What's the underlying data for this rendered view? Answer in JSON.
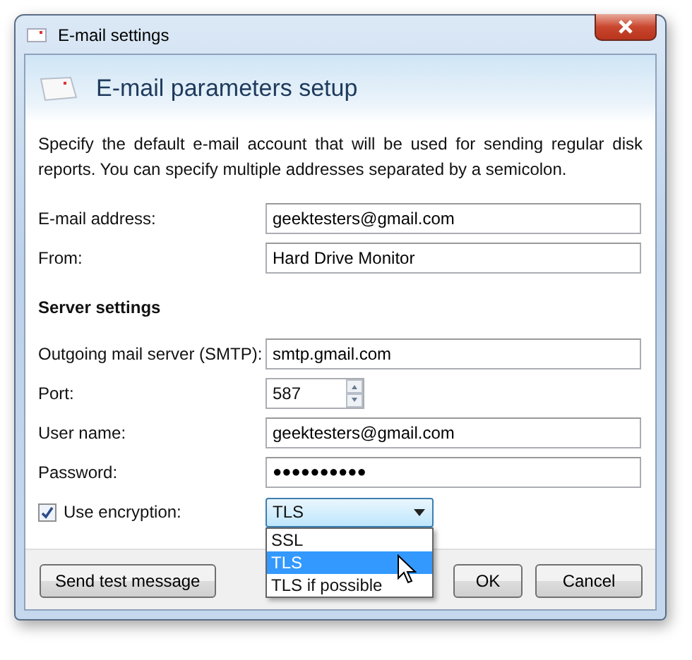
{
  "window": {
    "title": "E-mail settings"
  },
  "header": {
    "title": "E-mail parameters setup"
  },
  "description": "Specify the default e-mail account that will be used for sending regular disk reports. You can specify multiple addresses separated by a semicolon.",
  "fields": [
    {
      "label": "E-mail address:",
      "value": "geektesters@gmail.com"
    },
    {
      "label": "From:",
      "value": "Hard Drive Monitor"
    }
  ],
  "section": {
    "title": "Server settings"
  },
  "server_fields": [
    {
      "label": "Outgoing mail server (SMTP):",
      "value": "smtp.gmail.com",
      "kind": "text"
    },
    {
      "label": "Port:",
      "value": "587",
      "kind": "spinner"
    },
    {
      "label": "User name:",
      "value": "geektesters@gmail.com",
      "kind": "text"
    },
    {
      "label": "Password:",
      "value": "●●●●●●●●●●",
      "kind": "password"
    }
  ],
  "encryption": {
    "label": "Use encryption:",
    "checked": true,
    "value": "TLS",
    "expanded": true,
    "options": [
      {
        "label": "SSL",
        "selected": false
      },
      {
        "label": "TLS",
        "selected": true
      },
      {
        "label": "TLS if possible",
        "selected": false
      }
    ]
  },
  "buttons": [
    {
      "label": "Send test message",
      "kind": "left"
    },
    {
      "label": "OK",
      "kind": "right"
    },
    {
      "label": "Cancel",
      "kind": "right"
    }
  ]
}
